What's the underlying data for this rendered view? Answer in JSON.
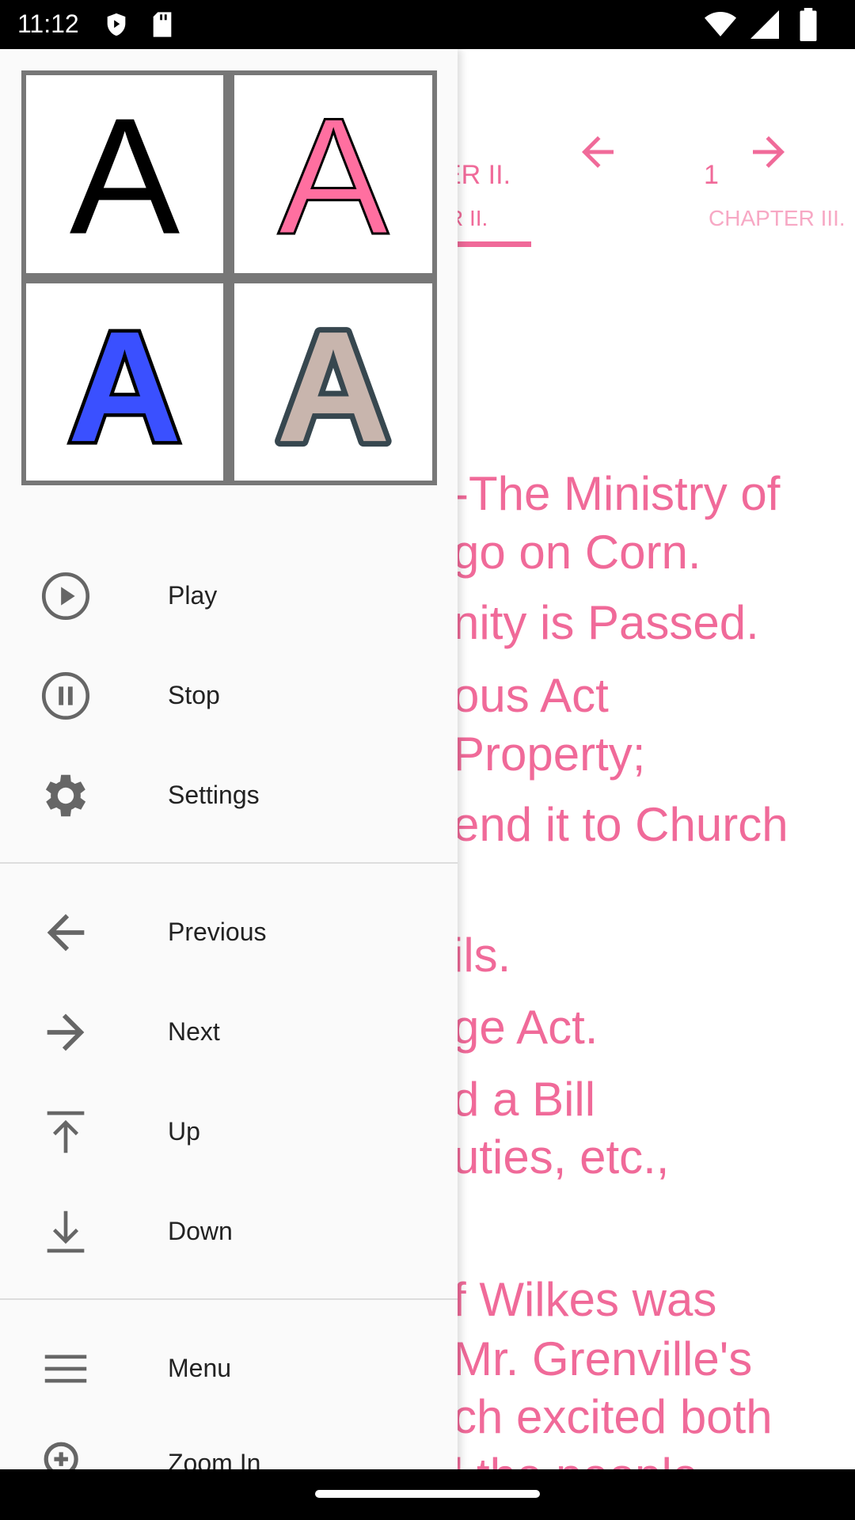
{
  "status_bar": {
    "time": "11:12"
  },
  "reader": {
    "tabs": [
      {
        "title": "ER II.",
        "subtitle": "R II.",
        "selected": true
      },
      {
        "title": "1",
        "subtitle": "CHAPTER III.",
        "selected": false
      }
    ],
    "accent": "#f06a99",
    "lines": [
      "-The Ministry of",
      "go on Corn.",
      "nity is Passed.",
      "ous Act",
      " Property;",
      "end it to Church",
      "ils.",
      "ge Act.",
      "d a Bill",
      "uties, etc.,",
      "f Wilkes was",
      " Mr. Grenville's",
      "ch excited both",
      "l the people"
    ]
  },
  "drawer": {
    "color_options": [
      "black",
      "pink",
      "blue",
      "tan"
    ],
    "items": [
      {
        "label": "Play",
        "icon": "play-circle-icon"
      },
      {
        "label": "Stop",
        "icon": "pause-circle-icon"
      },
      {
        "label": "Settings",
        "icon": "gear-icon"
      },
      {
        "label": "Previous",
        "icon": "arrow-left-icon"
      },
      {
        "label": "Next",
        "icon": "arrow-right-icon"
      },
      {
        "label": "Up",
        "icon": "arrow-up-to-top-icon"
      },
      {
        "label": "Down",
        "icon": "arrow-down-to-bottom-icon"
      },
      {
        "label": "Menu",
        "icon": "menu-icon"
      },
      {
        "label": "Zoom In",
        "icon": "zoom-in-icon"
      }
    ]
  }
}
